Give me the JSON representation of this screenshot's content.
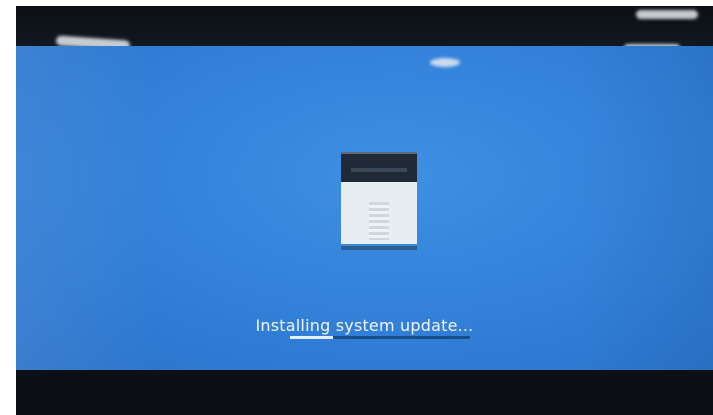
{
  "screen": {
    "status_text": "Installing system update...",
    "progress_fraction": 0.24,
    "background_color": "#3584dc"
  },
  "icons": {
    "device": "printer-device-icon"
  }
}
